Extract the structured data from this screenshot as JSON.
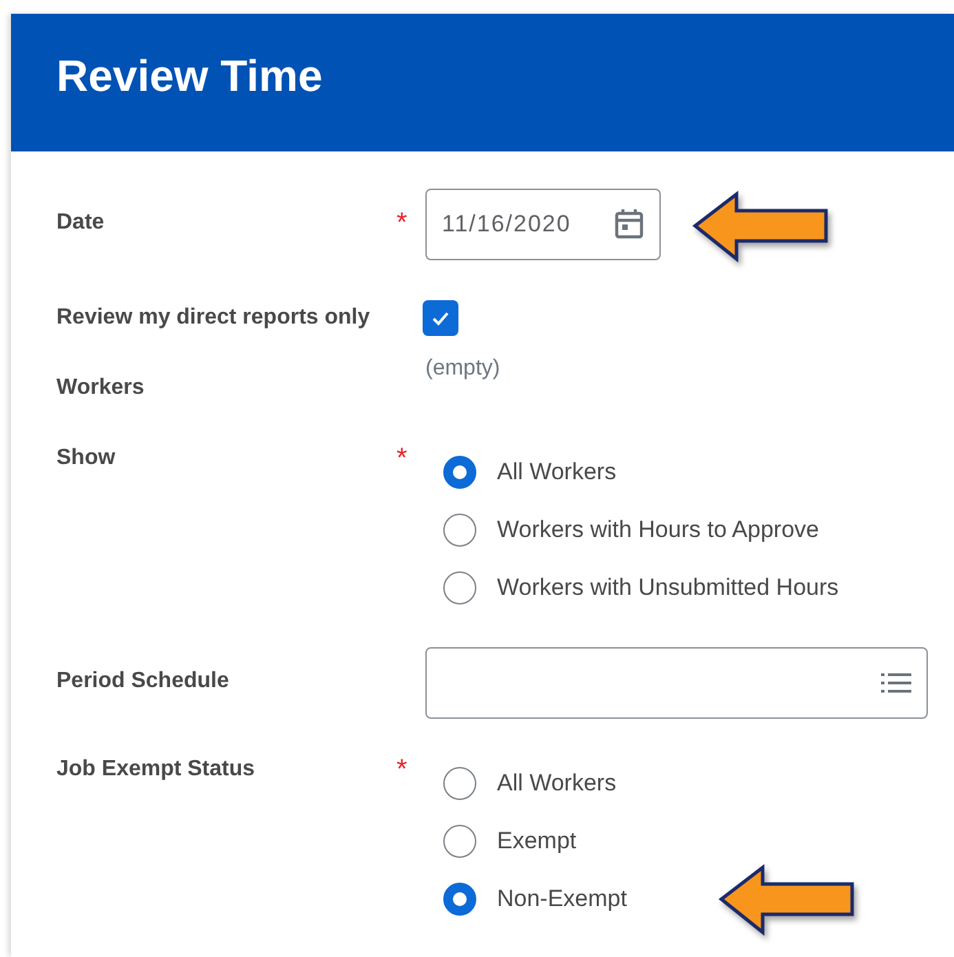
{
  "header": {
    "title": "Review Time"
  },
  "fields": [
    {
      "kind": "date",
      "label": "Date",
      "required_mark": "*",
      "value": "11/16/2020",
      "callout": true
    },
    {
      "kind": "checkbox",
      "label": "Review my direct reports only",
      "checked": true
    },
    {
      "kind": "readonly",
      "label": "Workers",
      "value": "(empty)"
    },
    {
      "kind": "radio",
      "label": "Show",
      "required_mark": "*",
      "options": [
        {
          "label": "All Workers",
          "selected": true,
          "callout": false
        },
        {
          "label": "Workers with Hours to Approve",
          "selected": false,
          "callout": false
        },
        {
          "label": "Workers with Unsubmitted Hours",
          "selected": false,
          "callout": false
        }
      ]
    },
    {
      "kind": "select",
      "label": "Period Schedule"
    },
    {
      "kind": "radio",
      "label": "Job Exempt Status",
      "required_mark": "*",
      "options": [
        {
          "label": "All Workers",
          "selected": false,
          "callout": false
        },
        {
          "label": "Exempt",
          "selected": false,
          "callout": false
        },
        {
          "label": "Non-Exempt",
          "selected": true,
          "callout": true
        }
      ]
    }
  ]
}
